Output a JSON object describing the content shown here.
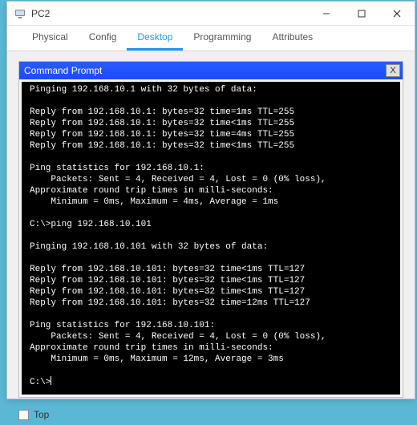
{
  "window": {
    "title": "PC2"
  },
  "tabs": [
    "Physical",
    "Config",
    "Desktop",
    "Programming",
    "Attributes"
  ],
  "active_tab": "Desktop",
  "subwindow": {
    "title": "Command Prompt"
  },
  "terminal": {
    "lines": [
      "",
      "Pinging 192.168.10.1 with 32 bytes of data:",
      "",
      "Reply from 192.168.10.1: bytes=32 time=1ms TTL=255",
      "Reply from 192.168.10.1: bytes=32 time<1ms TTL=255",
      "Reply from 192.168.10.1: bytes=32 time=4ms TTL=255",
      "Reply from 192.168.10.1: bytes=32 time<1ms TTL=255",
      "",
      "Ping statistics for 192.168.10.1:",
      "    Packets: Sent = 4, Received = 4, Lost = 0 (0% loss),",
      "Approximate round trip times in milli-seconds:",
      "    Minimum = 0ms, Maximum = 4ms, Average = 1ms",
      "",
      "C:\\>ping 192.168.10.101",
      "",
      "Pinging 192.168.10.101 with 32 bytes of data:",
      "",
      "Reply from 192.168.10.101: bytes=32 time<1ms TTL=127",
      "Reply from 192.168.10.101: bytes=32 time<1ms TTL=127",
      "Reply from 192.168.10.101: bytes=32 time<1ms TTL=127",
      "Reply from 192.168.10.101: bytes=32 time=12ms TTL=127",
      "",
      "Ping statistics for 192.168.10.101:",
      "    Packets: Sent = 4, Received = 4, Lost = 0 (0% loss),",
      "Approximate round trip times in milli-seconds:",
      "    Minimum = 0ms, Maximum = 12ms, Average = 3ms",
      ""
    ],
    "prompt": "C:\\>"
  },
  "footer": {
    "top_label": "Top"
  }
}
